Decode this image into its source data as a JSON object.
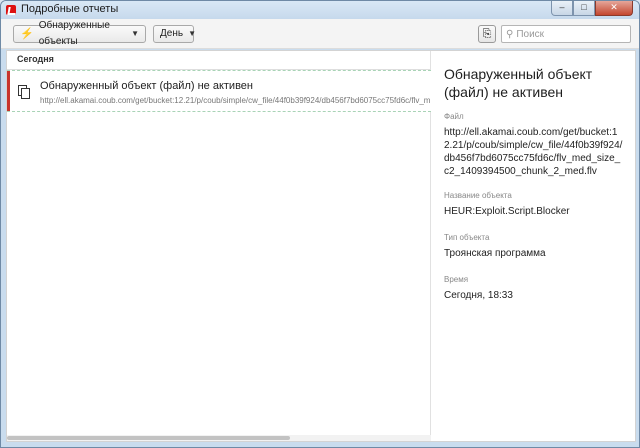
{
  "window": {
    "title": "Подробные отчеты",
    "controls": {
      "minimize": "–",
      "maximize": "□",
      "close": "✕"
    }
  },
  "toolbar": {
    "filter_label": "Обнаруженные объекты",
    "filter_icon": "lightning-icon",
    "period_label": "День",
    "export_icon": "export-icon",
    "search_placeholder": "Поиск"
  },
  "list": {
    "group_header": "Сегодня",
    "rows": [
      {
        "icon": "file-copy-icon",
        "title": "Обнаруженный объект (файл) не активен",
        "subtitle": "http://ell.akamai.coub.com/get/bucket:12.21/p/coub/simple/cw_file/44f0b39f924/db456f7bd6075cc75fd6c/flv_med_",
        "severity_color": "#c8342c"
      }
    ]
  },
  "detail": {
    "title": "Обнаруженный объект (файл) не активен",
    "file_label": "Файл",
    "file_value": "http://ell.akamai.coub.com/get/bucket:12.21/p/coub/simple/cw_file/44f0b39f924/db456f7bd6075cc75fd6c/flv_med_size_c2_1409394500_chunk_2_med.flv",
    "object_name_label": "Название объекта",
    "object_name_value": "HEUR:Exploit.Script.Blocker",
    "object_type_label": "Тип объекта",
    "object_type_value": "Троянская программа",
    "time_label": "Время",
    "time_value": "Сегодня, 18:33"
  },
  "colors": {
    "accent": "#c8342c",
    "row_border": "#a9d3b6"
  }
}
